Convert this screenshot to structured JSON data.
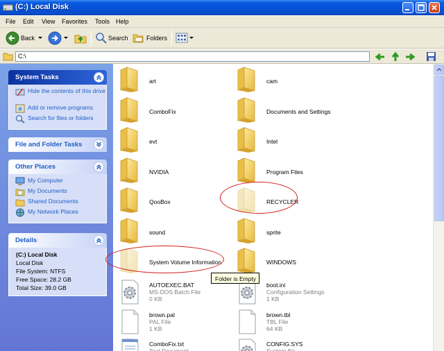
{
  "window": {
    "title": "(C:) Local Disk"
  },
  "menu": [
    "File",
    "Edit",
    "View",
    "Favorites",
    "Tools",
    "Help"
  ],
  "toolbar": {
    "back": "Back",
    "search": "Search",
    "folders": "Folders"
  },
  "address": {
    "value": "C:\\"
  },
  "tasks": {
    "system": {
      "title": "System Tasks",
      "items": [
        "Hide the contents of this drive",
        "Add or remove programs",
        "Search for files or folders"
      ]
    },
    "file_folder": {
      "title": "File and Folder Tasks"
    },
    "other_places": {
      "title": "Other Places",
      "items": [
        "My Computer",
        "My Documents",
        "Shared Documents",
        "My Network Places"
      ]
    },
    "details": {
      "title": "Details",
      "name": "(C:) Local Disk",
      "type": "Local Disk",
      "fs": "File System: NTFS",
      "free": "Free Space: 28.2 GB",
      "total": "Total Size: 39.0 GB"
    }
  },
  "folders": [
    "art",
    "cam",
    "ComboFix",
    "Documents and Settings",
    "evt",
    "Intel",
    "NVIDIA",
    "Program Files",
    "QooBox",
    "RECYCLER",
    "sound",
    "sprite",
    "System Volume Information",
    "WINDOWS"
  ],
  "files": [
    {
      "name": "AUTOEXEC.BAT",
      "type": "MS-DOS Batch File",
      "size": "0 KB"
    },
    {
      "name": "boot.ini",
      "type": "Configuration Settings",
      "size": "1 KB"
    },
    {
      "name": "brown.pal",
      "type": "PAL File",
      "size": "1 KB"
    },
    {
      "name": "brown.tbl",
      "type": "TBL File",
      "size": "64 KB"
    },
    {
      "name": "ComboFix.txt",
      "type": "Text Document"
    },
    {
      "name": "CONFIG.SYS",
      "type": "System file"
    }
  ],
  "tooltip": "Folder is Empty",
  "colors": {
    "title_bar": "#0551d8",
    "task_pane": "#6f8de0",
    "link": "#215dc6",
    "annotation": "#d21b1b"
  }
}
